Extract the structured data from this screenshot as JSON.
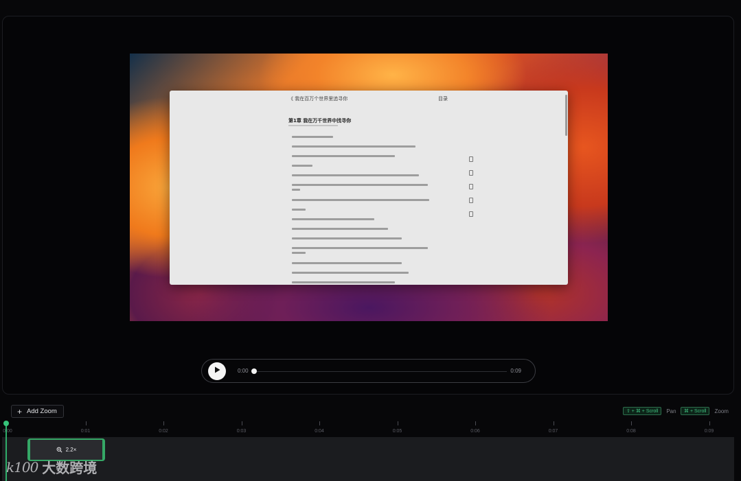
{
  "preview": {
    "document": {
      "back_text": "《 我在百万个世界里追寻你",
      "directory_label": "目录",
      "chapter_title": "第1章 我在万千世界中找寻你"
    }
  },
  "player": {
    "current_time": "0:00",
    "total_time": "0:09",
    "progress": 0.0,
    "play_icon": "play-icon"
  },
  "toolbar": {
    "add_zoom_label": "Add Zoom",
    "pan_hint_key": "⇧ + ⌘ + Scroll",
    "pan_hint_label": "Pan",
    "zoom_hint_key": "⌘ + Scroll",
    "zoom_hint_label": "Zoom"
  },
  "timeline": {
    "ticks": [
      "0:00",
      "0:01",
      "0:02",
      "0:03",
      "0:04",
      "0:05",
      "0:06",
      "0:07",
      "0:08",
      "0:09"
    ],
    "zoom_segments": [
      {
        "label": "2.2×"
      }
    ]
  },
  "watermark": {
    "logo": "k100",
    "text": "大数跨境"
  },
  "colors": {
    "accent": "#35a866",
    "background": "#070709"
  }
}
